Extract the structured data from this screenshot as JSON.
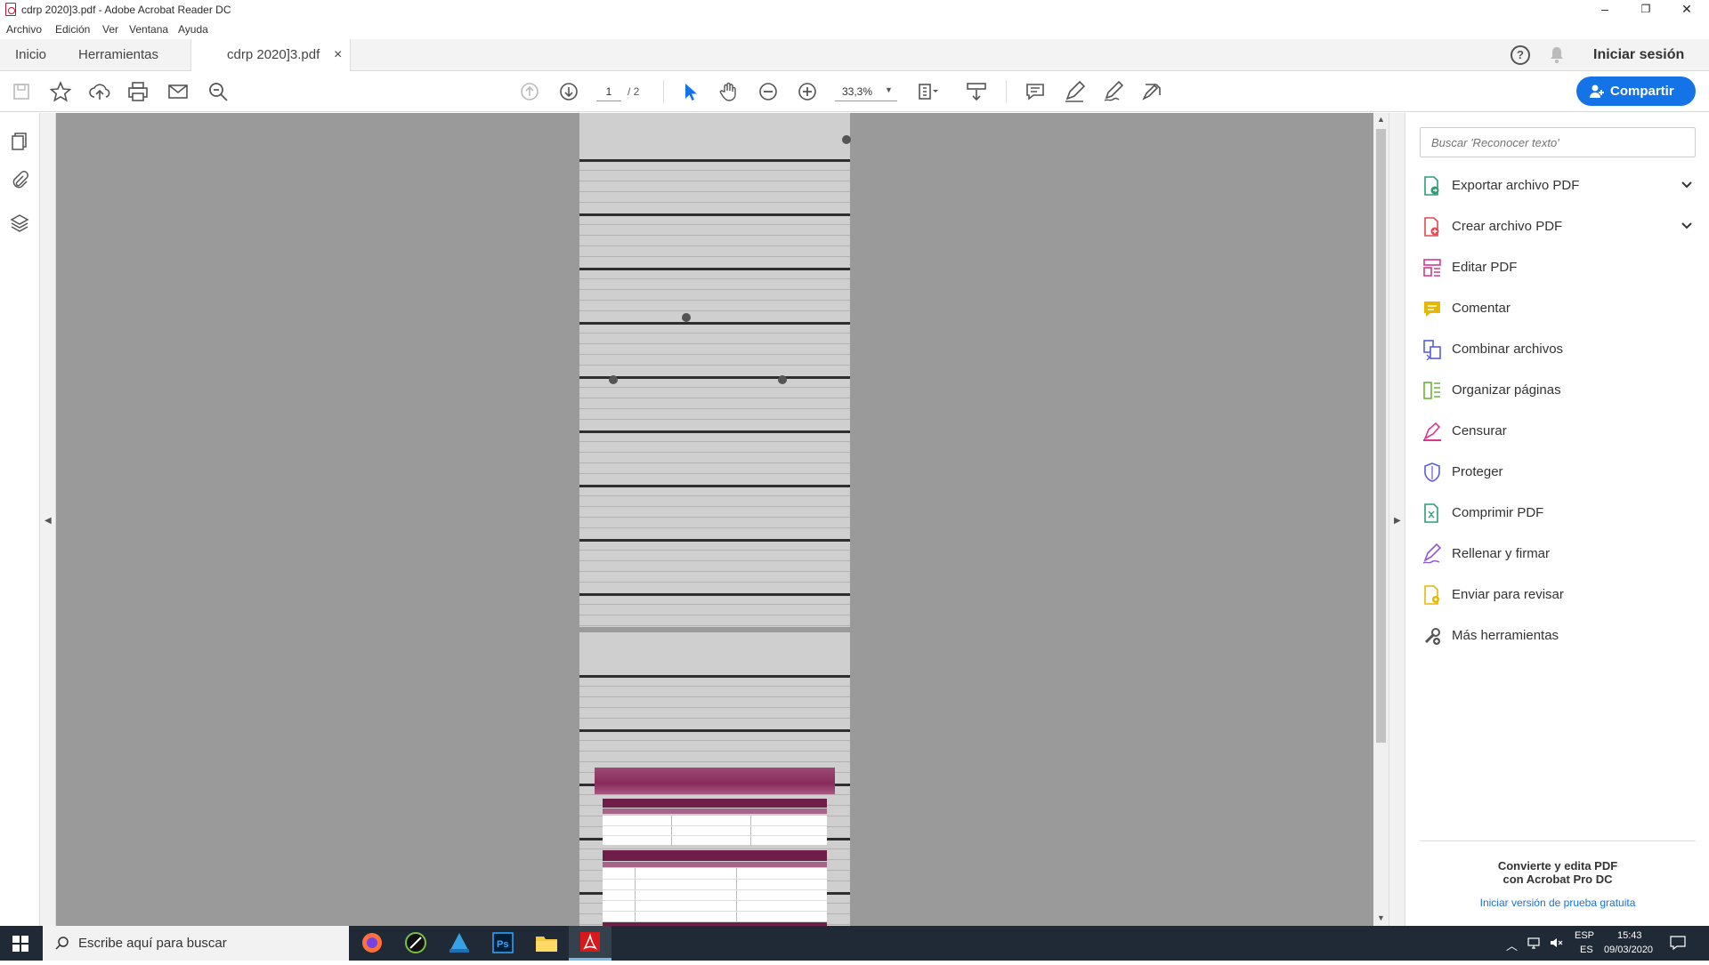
{
  "window": {
    "title": "cdrp 2020]3.pdf - Adobe Acrobat Reader DC",
    "controls": {
      "minimize": "–",
      "restore": "❐",
      "close": "✕"
    }
  },
  "menu": [
    "Archivo",
    "Edición",
    "Ver",
    "Ventana",
    "Ayuda"
  ],
  "tabs": {
    "home": "Inicio",
    "tools": "Herramientas",
    "document": "cdrp 2020]3.pdf",
    "close": "×"
  },
  "header_right": {
    "sign_in": "Iniciar sesión"
  },
  "toolbar": {
    "page_current": "1",
    "page_total": "/ 2",
    "zoom": "33,3%",
    "share_label": "Compartir"
  },
  "right_panel": {
    "search_placeholder": "Buscar 'Reconocer texto'",
    "tools": [
      {
        "label": "Exportar archivo PDF",
        "icon": "export-pdf-icon",
        "color": "#2d9d78",
        "expandable": true
      },
      {
        "label": "Crear archivo PDF",
        "icon": "create-pdf-icon",
        "color": "#e34850",
        "expandable": true
      },
      {
        "label": "Editar PDF",
        "icon": "edit-pdf-icon",
        "color": "#d83790",
        "expandable": false
      },
      {
        "label": "Comentar",
        "icon": "comment-icon",
        "color": "#e8b800",
        "expandable": false
      },
      {
        "label": "Combinar archivos",
        "icon": "combine-files-icon",
        "color": "#5c5ce0",
        "expandable": false
      },
      {
        "label": "Organizar páginas",
        "icon": "organize-pages-icon",
        "color": "#6bb536",
        "expandable": false
      },
      {
        "label": "Censurar",
        "icon": "redact-icon",
        "color": "#d83790",
        "expandable": false
      },
      {
        "label": "Proteger",
        "icon": "protect-icon",
        "color": "#5c5ce0",
        "expandable": false
      },
      {
        "label": "Comprimir PDF",
        "icon": "compress-pdf-icon",
        "color": "#2d9d78",
        "expandable": false
      },
      {
        "label": "Rellenar y firmar",
        "icon": "fill-sign-icon",
        "color": "#9256d9",
        "expandable": false
      },
      {
        "label": "Enviar para revisar",
        "icon": "send-review-icon",
        "color": "#e8b800",
        "expandable": false
      },
      {
        "label": "Más herramientas",
        "icon": "more-tools-icon",
        "color": "#555555",
        "expandable": false
      }
    ],
    "promo": {
      "line1": "Convierte y edita PDF",
      "line2": "con Acrobat Pro DC",
      "link": "Iniciar versión de prueba gratuita"
    }
  },
  "taskbar": {
    "search_placeholder": "Escribe aquí para buscar",
    "apps": [
      "firefox-icon",
      "corel-icon",
      "app-blue-icon",
      "photoshop-icon",
      "file-explorer-icon",
      "acrobat-icon"
    ],
    "language_top": "ESP",
    "language_bottom": "ES",
    "time": "15:43",
    "date": "09/03/2020"
  },
  "colors": {
    "accent": "#1473e6",
    "doc_bg": "#9a9a9a",
    "taskbar_bg": "#1f2a36",
    "plum": "#8a2a5c"
  }
}
